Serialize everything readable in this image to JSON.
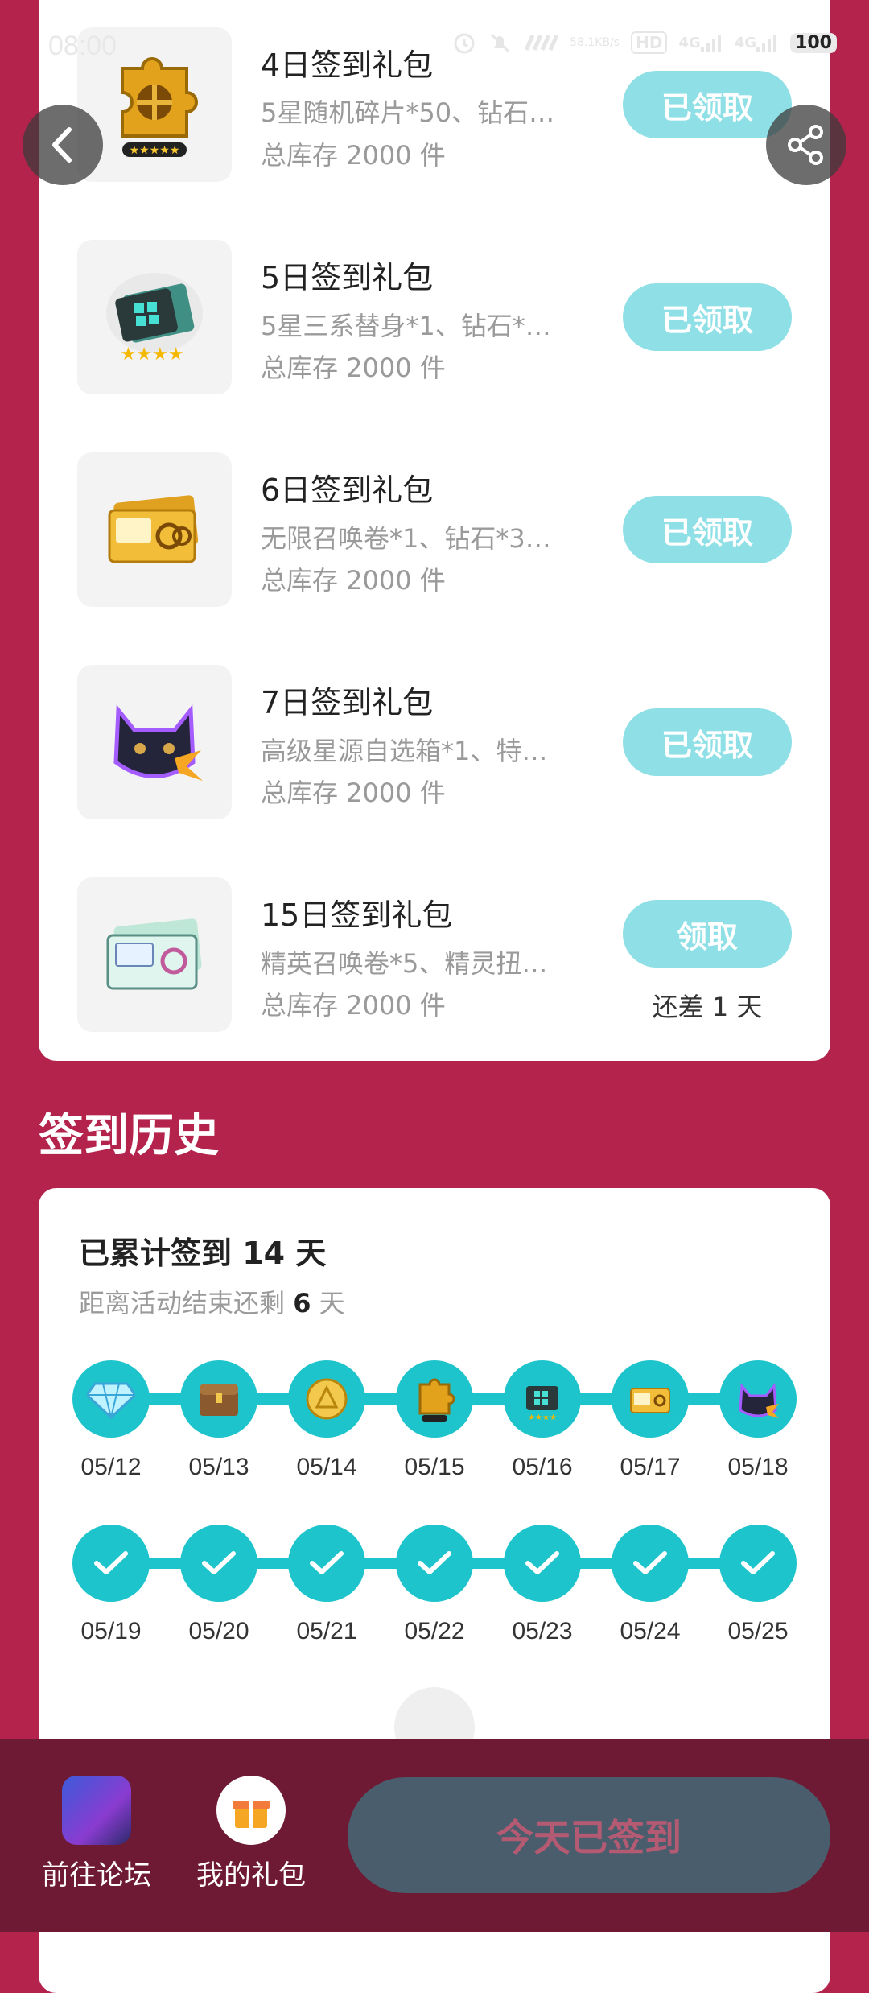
{
  "status_bar": {
    "time": "08:00",
    "net_speed_value": "58.1",
    "net_speed_unit": "KB/s",
    "hd_label": "HD",
    "network_1": "4G",
    "network_2": "4G",
    "battery": "100"
  },
  "gifts": [
    {
      "title": "4日签到礼包",
      "desc": "5星随机碎片*50、钻石…",
      "stock": "总库存 2000 件",
      "button": "已领取",
      "icon": "golden-puzzle-piece-icon"
    },
    {
      "title": "5日签到礼包",
      "desc": "5星三系替身*1、钻石*…",
      "stock": "总库存 2000 件",
      "button": "已领取",
      "icon": "substitute-card-icon"
    },
    {
      "title": "6日签到礼包",
      "desc": "无限召唤卷*1、钻石*3…",
      "stock": "总库存 2000 件",
      "button": "已领取",
      "icon": "summon-ticket-icon"
    },
    {
      "title": "7日签到礼包",
      "desc": "高级星源自选箱*1、特…",
      "stock": "总库存 2000 件",
      "button": "已领取",
      "icon": "black-cat-icon"
    },
    {
      "title": "15日签到礼包",
      "desc": "精英召唤卷*5、精灵扭…",
      "stock": "总库存 2000 件",
      "button": "领取",
      "note": "还差 1 天",
      "icon": "elite-ticket-icon"
    }
  ],
  "history": {
    "section_title": "签到历史",
    "total_label": "已累计签到 14 天",
    "remain_prefix": "距离活动结束还剩",
    "remain_days": "6",
    "remain_suffix": "天",
    "week1": [
      {
        "date": "05/12",
        "icon": "diamond-icon"
      },
      {
        "date": "05/13",
        "icon": "treasure-chest-icon"
      },
      {
        "date": "05/14",
        "icon": "gold-coin-icon"
      },
      {
        "date": "05/15",
        "icon": "golden-puzzle-piece-icon"
      },
      {
        "date": "05/16",
        "icon": "substitute-card-icon"
      },
      {
        "date": "05/17",
        "icon": "summon-ticket-icon"
      },
      {
        "date": "05/18",
        "icon": "black-cat-icon"
      }
    ],
    "week2": [
      {
        "date": "05/19",
        "icon": "check-icon"
      },
      {
        "date": "05/20",
        "icon": "check-icon"
      },
      {
        "date": "05/21",
        "icon": "check-icon"
      },
      {
        "date": "05/22",
        "icon": "check-icon"
      },
      {
        "date": "05/23",
        "icon": "check-icon"
      },
      {
        "date": "05/24",
        "icon": "check-icon"
      },
      {
        "date": "05/25",
        "icon": "check-icon"
      }
    ]
  },
  "bottom_bar": {
    "forum_label": "前往论坛",
    "gifts_label": "我的礼包",
    "signed_label": "今天已签到"
  },
  "colors": {
    "page_bg": "#b3234c",
    "accent_teal": "#1ec4cc",
    "claimed_button": "#8ee0e6",
    "bottom_bar": "#6f1a34",
    "signed_button": "#4a5d6c"
  }
}
